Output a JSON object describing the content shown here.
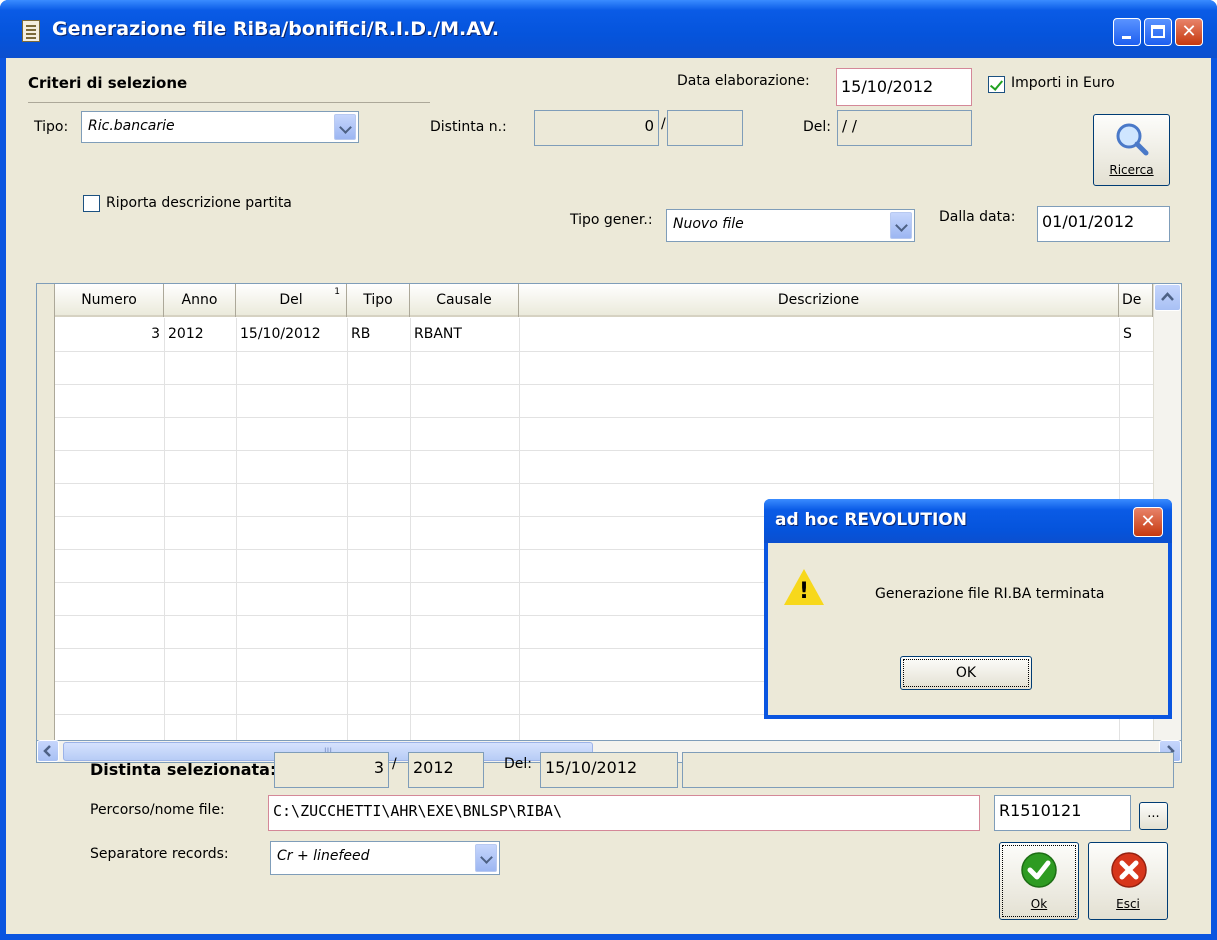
{
  "window": {
    "title": "Generazione file RiBa/bonifici/R.I.D./M.AV."
  },
  "criteria": {
    "heading": "Criteri di selezione",
    "tipo_label": "Tipo:",
    "tipo_value": "Ric.bancarie",
    "data_elab_label": "Data elaborazione:",
    "data_elab_value": "15/10/2012",
    "importi_euro_label": "Importi in Euro",
    "importi_euro_checked": true,
    "distinta_label": "Distinta n.:",
    "distinta_num": "0",
    "distinta_sep": "/",
    "distinta_suffix": "",
    "del_label": "Del:",
    "del_value": "/  /",
    "riporta_label": "Riporta descrizione partita",
    "riporta_checked": false,
    "tipo_gener_label": "Tipo gener.:",
    "tipo_gener_value": "Nuovo file",
    "dalla_data_label": "Dalla data:",
    "dalla_data_value": "01/01/2012",
    "ricerca_label": "Ricerca"
  },
  "grid": {
    "columns": [
      "Numero",
      "Anno",
      "Del",
      "Tipo",
      "Causale",
      "Descrizione",
      "De"
    ],
    "sort_indicator": "1",
    "rows": [
      {
        "numero": "3",
        "anno": "2012",
        "del": "15/10/2012",
        "tipo": "RB",
        "causale": "RBANT",
        "descrizione": "",
        "de": "S"
      }
    ],
    "hscroll_grip": "III"
  },
  "selected": {
    "label": "Distinta selezionata:",
    "num": "3",
    "sep": "/",
    "anno": "2012",
    "del_label": "Del:",
    "del_value": "15/10/2012",
    "extra": "",
    "percorso_label": "Percorso/nome file:",
    "percorso_value": "C:\\ZUCCHETTI\\AHR\\EXE\\BNLSP\\RIBA\\",
    "file_name": "R1510121",
    "browse_label": "...",
    "separatore_label": "Separatore records:",
    "separatore_value": "Cr + linefeed",
    "ok_label": "Ok",
    "esci_label": "Esci"
  },
  "dialog": {
    "title": "ad hoc REVOLUTION",
    "message": "Generazione file RI.BA terminata",
    "ok_label": "OK"
  },
  "colors": {
    "titlebar": "#0554dc",
    "face": "#ece9d8",
    "field_border": "#7f9db9",
    "ok_green": "#2e9b22",
    "esci_red": "#d7361b"
  }
}
